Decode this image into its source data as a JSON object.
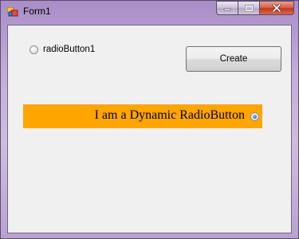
{
  "window": {
    "title": "Form1",
    "icons": {
      "app": "form-app-icon",
      "minimize": "minimize-icon",
      "maximize": "maximize-icon",
      "close": "close-icon"
    }
  },
  "form": {
    "radio_button_1": {
      "label": "radioButton1",
      "checked": false
    },
    "create_button": {
      "label": "Create"
    },
    "dynamic_radio": {
      "label": "I am a Dynamic RadioButton",
      "checked": true,
      "background_color": "#ffa500"
    }
  },
  "colors": {
    "client_background": "#f0f0f0",
    "close_button": "#c94a32"
  }
}
